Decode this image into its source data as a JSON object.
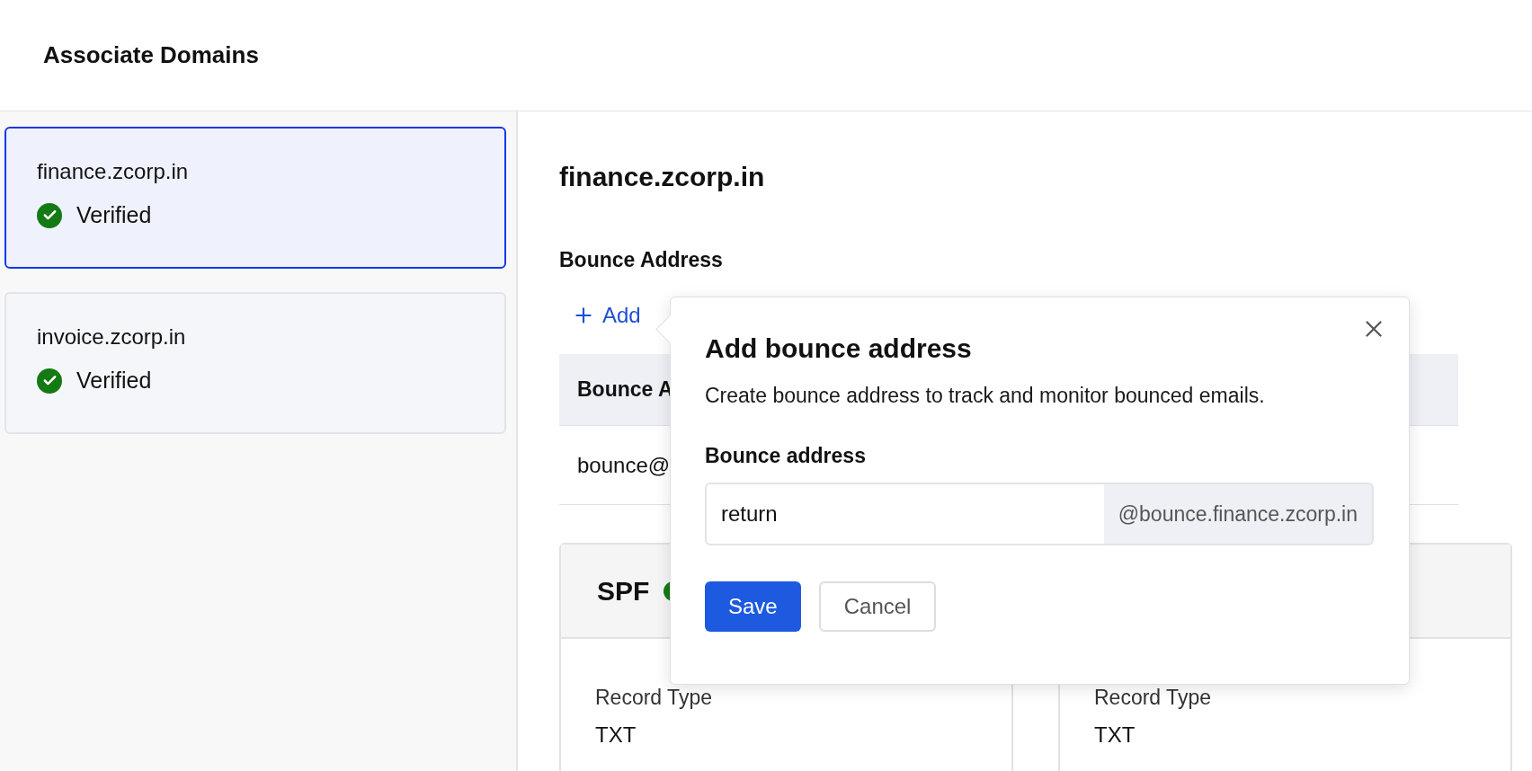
{
  "header": {
    "title": "Associate Domains"
  },
  "domains": [
    {
      "name": "finance.zcorp.in",
      "status": "Verified",
      "verified": true,
      "selected": true
    },
    {
      "name": "invoice.zcorp.in",
      "status": "Verified",
      "verified": true,
      "selected": false
    }
  ],
  "detail": {
    "title": "finance.zcorp.in",
    "section_title": "Bounce Address",
    "add_label": "Add"
  },
  "bounce_table": {
    "columns": [
      "Bounce A"
    ],
    "rows": [
      [
        "bounce@"
      ]
    ]
  },
  "record_card": {
    "title": "SPF",
    "verified": true,
    "fields": [
      {
        "label": "Record Type",
        "value": "TXT"
      },
      {
        "label": "Record Type",
        "value": "TXT"
      }
    ]
  },
  "popover": {
    "title": "Add bounce address",
    "description": "Create bounce address to track and monitor bounced emails.",
    "field": {
      "label": "Bounce address",
      "value": "return",
      "suffix": "@bounce.finance.zcorp.in"
    },
    "buttons": [
      {
        "label": "Save",
        "kind": "primary"
      },
      {
        "label": "Cancel",
        "kind": "secondary"
      }
    ]
  }
}
